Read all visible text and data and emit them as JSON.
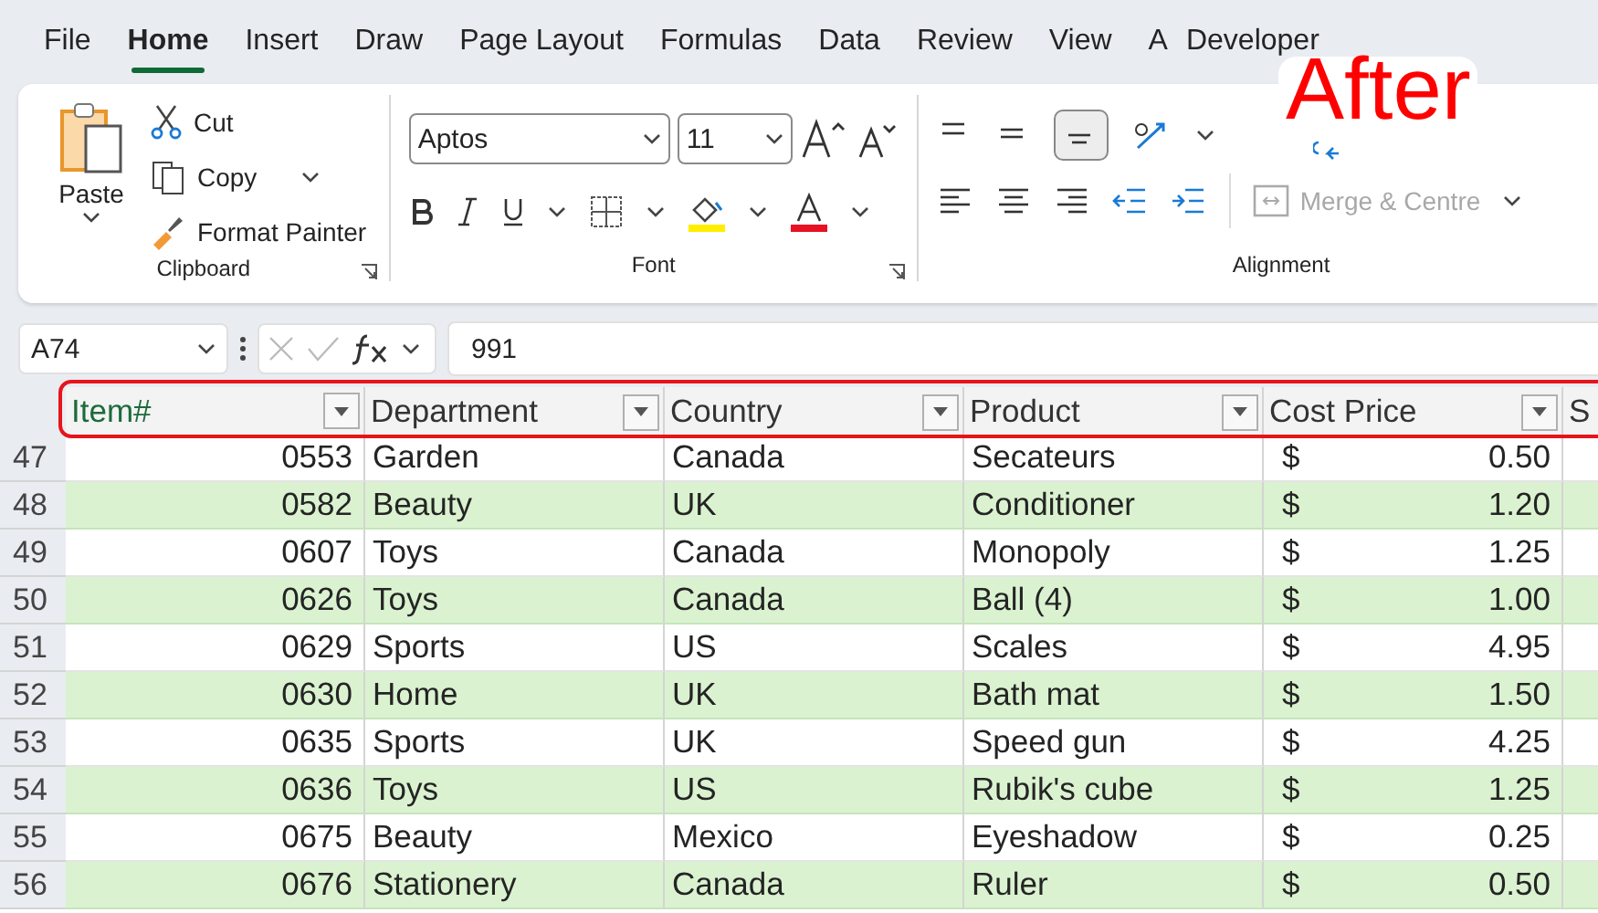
{
  "tabs": [
    {
      "label": "File",
      "selected": false
    },
    {
      "label": "Home",
      "selected": true
    },
    {
      "label": "Insert",
      "selected": false
    },
    {
      "label": "Draw",
      "selected": false
    },
    {
      "label": "Page Layout",
      "selected": false
    },
    {
      "label": "Formulas",
      "selected": false
    },
    {
      "label": "Data",
      "selected": false
    },
    {
      "label": "Review",
      "selected": false
    },
    {
      "label": "View",
      "selected": false
    },
    {
      "label": "A",
      "selected": false
    },
    {
      "label": "Developer",
      "selected": false
    }
  ],
  "annotation": "After",
  "clipboard": {
    "paste": "Paste",
    "cut": "Cut",
    "copy": "Copy",
    "format_painter": "Format Painter",
    "label": "Clipboard"
  },
  "font": {
    "name": "Aptos",
    "size": "11",
    "label": "Font"
  },
  "alignment": {
    "merge": "Merge & Centre",
    "merge_disabled": true,
    "label": "Alignment"
  },
  "formula_bar": {
    "name_box": "A74",
    "value": "991"
  },
  "table": {
    "columns": [
      "Item#",
      "Department",
      "Country",
      "Product",
      "Cost Price",
      "S"
    ],
    "rows": [
      {
        "row": "47",
        "item": "0553",
        "department": "Garden",
        "country": "Canada",
        "product": "Secateurs",
        "currency": "$",
        "cost": "0.50",
        "banded": false
      },
      {
        "row": "48",
        "item": "0582",
        "department": "Beauty",
        "country": "UK",
        "product": "Conditioner",
        "currency": "$",
        "cost": "1.20",
        "banded": true
      },
      {
        "row": "49",
        "item": "0607",
        "department": "Toys",
        "country": "Canada",
        "product": "Monopoly",
        "currency": "$",
        "cost": "1.25",
        "banded": false
      },
      {
        "row": "50",
        "item": "0626",
        "department": "Toys",
        "country": "Canada",
        "product": "Ball (4)",
        "currency": "$",
        "cost": "1.00",
        "banded": true
      },
      {
        "row": "51",
        "item": "0629",
        "department": "Sports",
        "country": "US",
        "product": "Scales",
        "currency": "$",
        "cost": "4.95",
        "banded": false
      },
      {
        "row": "52",
        "item": "0630",
        "department": "Home",
        "country": "UK",
        "product": "Bath mat",
        "currency": "$",
        "cost": "1.50",
        "banded": true
      },
      {
        "row": "53",
        "item": "0635",
        "department": "Sports",
        "country": "UK",
        "product": "Speed gun",
        "currency": "$",
        "cost": "4.25",
        "banded": false
      },
      {
        "row": "54",
        "item": "0636",
        "department": "Toys",
        "country": "US",
        "product": "Rubik's cube",
        "currency": "$",
        "cost": "1.25",
        "banded": true
      },
      {
        "row": "55",
        "item": "0675",
        "department": "Beauty",
        "country": "Mexico",
        "product": "Eyeshadow",
        "currency": "$",
        "cost": "0.25",
        "banded": false
      },
      {
        "row": "56",
        "item": "0676",
        "department": "Stationery",
        "country": "Canada",
        "product": "Ruler",
        "currency": "$",
        "cost": "0.50",
        "banded": true
      }
    ]
  }
}
